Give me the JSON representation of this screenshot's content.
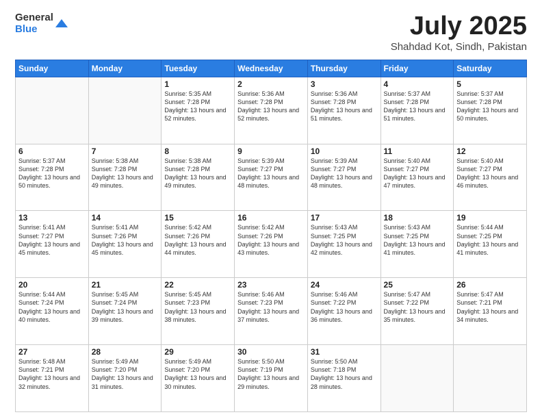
{
  "header": {
    "logo_general": "General",
    "logo_blue": "Blue",
    "title": "July 2025",
    "location": "Shahdad Kot, Sindh, Pakistan"
  },
  "weekdays": [
    "Sunday",
    "Monday",
    "Tuesday",
    "Wednesday",
    "Thursday",
    "Friday",
    "Saturday"
  ],
  "weeks": [
    [
      {
        "day": "",
        "info": ""
      },
      {
        "day": "",
        "info": ""
      },
      {
        "day": "1",
        "info": "Sunrise: 5:35 AM\nSunset: 7:28 PM\nDaylight: 13 hours and 52 minutes."
      },
      {
        "day": "2",
        "info": "Sunrise: 5:36 AM\nSunset: 7:28 PM\nDaylight: 13 hours and 52 minutes."
      },
      {
        "day": "3",
        "info": "Sunrise: 5:36 AM\nSunset: 7:28 PM\nDaylight: 13 hours and 51 minutes."
      },
      {
        "day": "4",
        "info": "Sunrise: 5:37 AM\nSunset: 7:28 PM\nDaylight: 13 hours and 51 minutes."
      },
      {
        "day": "5",
        "info": "Sunrise: 5:37 AM\nSunset: 7:28 PM\nDaylight: 13 hours and 50 minutes."
      }
    ],
    [
      {
        "day": "6",
        "info": "Sunrise: 5:37 AM\nSunset: 7:28 PM\nDaylight: 13 hours and 50 minutes."
      },
      {
        "day": "7",
        "info": "Sunrise: 5:38 AM\nSunset: 7:28 PM\nDaylight: 13 hours and 49 minutes."
      },
      {
        "day": "8",
        "info": "Sunrise: 5:38 AM\nSunset: 7:28 PM\nDaylight: 13 hours and 49 minutes."
      },
      {
        "day": "9",
        "info": "Sunrise: 5:39 AM\nSunset: 7:27 PM\nDaylight: 13 hours and 48 minutes."
      },
      {
        "day": "10",
        "info": "Sunrise: 5:39 AM\nSunset: 7:27 PM\nDaylight: 13 hours and 48 minutes."
      },
      {
        "day": "11",
        "info": "Sunrise: 5:40 AM\nSunset: 7:27 PM\nDaylight: 13 hours and 47 minutes."
      },
      {
        "day": "12",
        "info": "Sunrise: 5:40 AM\nSunset: 7:27 PM\nDaylight: 13 hours and 46 minutes."
      }
    ],
    [
      {
        "day": "13",
        "info": "Sunrise: 5:41 AM\nSunset: 7:27 PM\nDaylight: 13 hours and 45 minutes."
      },
      {
        "day": "14",
        "info": "Sunrise: 5:41 AM\nSunset: 7:26 PM\nDaylight: 13 hours and 45 minutes."
      },
      {
        "day": "15",
        "info": "Sunrise: 5:42 AM\nSunset: 7:26 PM\nDaylight: 13 hours and 44 minutes."
      },
      {
        "day": "16",
        "info": "Sunrise: 5:42 AM\nSunset: 7:26 PM\nDaylight: 13 hours and 43 minutes."
      },
      {
        "day": "17",
        "info": "Sunrise: 5:43 AM\nSunset: 7:25 PM\nDaylight: 13 hours and 42 minutes."
      },
      {
        "day": "18",
        "info": "Sunrise: 5:43 AM\nSunset: 7:25 PM\nDaylight: 13 hours and 41 minutes."
      },
      {
        "day": "19",
        "info": "Sunrise: 5:44 AM\nSunset: 7:25 PM\nDaylight: 13 hours and 41 minutes."
      }
    ],
    [
      {
        "day": "20",
        "info": "Sunrise: 5:44 AM\nSunset: 7:24 PM\nDaylight: 13 hours and 40 minutes."
      },
      {
        "day": "21",
        "info": "Sunrise: 5:45 AM\nSunset: 7:24 PM\nDaylight: 13 hours and 39 minutes."
      },
      {
        "day": "22",
        "info": "Sunrise: 5:45 AM\nSunset: 7:23 PM\nDaylight: 13 hours and 38 minutes."
      },
      {
        "day": "23",
        "info": "Sunrise: 5:46 AM\nSunset: 7:23 PM\nDaylight: 13 hours and 37 minutes."
      },
      {
        "day": "24",
        "info": "Sunrise: 5:46 AM\nSunset: 7:22 PM\nDaylight: 13 hours and 36 minutes."
      },
      {
        "day": "25",
        "info": "Sunrise: 5:47 AM\nSunset: 7:22 PM\nDaylight: 13 hours and 35 minutes."
      },
      {
        "day": "26",
        "info": "Sunrise: 5:47 AM\nSunset: 7:21 PM\nDaylight: 13 hours and 34 minutes."
      }
    ],
    [
      {
        "day": "27",
        "info": "Sunrise: 5:48 AM\nSunset: 7:21 PM\nDaylight: 13 hours and 32 minutes."
      },
      {
        "day": "28",
        "info": "Sunrise: 5:49 AM\nSunset: 7:20 PM\nDaylight: 13 hours and 31 minutes."
      },
      {
        "day": "29",
        "info": "Sunrise: 5:49 AM\nSunset: 7:20 PM\nDaylight: 13 hours and 30 minutes."
      },
      {
        "day": "30",
        "info": "Sunrise: 5:50 AM\nSunset: 7:19 PM\nDaylight: 13 hours and 29 minutes."
      },
      {
        "day": "31",
        "info": "Sunrise: 5:50 AM\nSunset: 7:18 PM\nDaylight: 13 hours and 28 minutes."
      },
      {
        "day": "",
        "info": ""
      },
      {
        "day": "",
        "info": ""
      }
    ]
  ]
}
